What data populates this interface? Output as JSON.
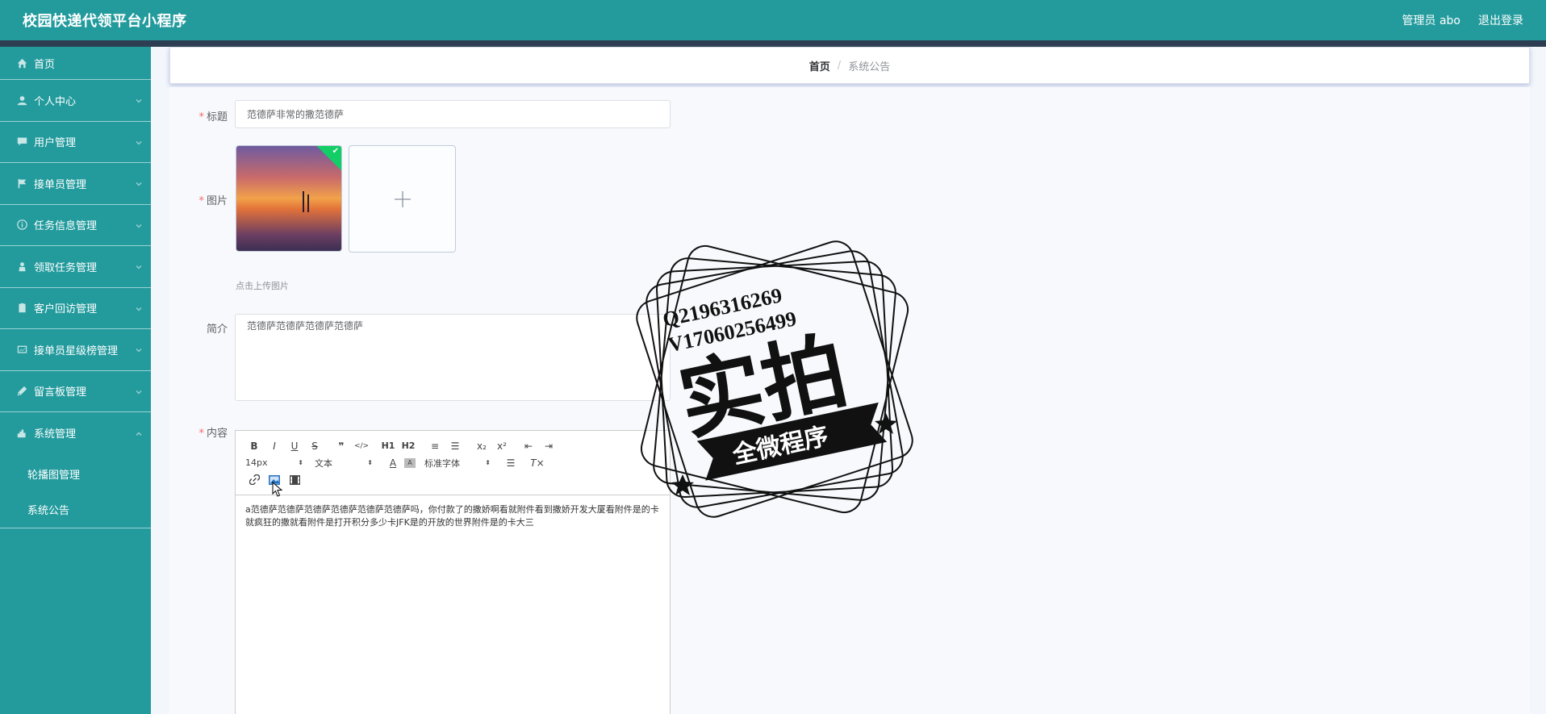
{
  "header": {
    "title": "校园快递代领平台小程序",
    "user_label": "管理员 abo",
    "logout_label": "退出登录"
  },
  "sidebar": {
    "items": [
      {
        "label": "首页",
        "icon": "home-icon"
      },
      {
        "label": "个人中心",
        "icon": "user-icon"
      },
      {
        "label": "用户管理",
        "icon": "chat-icon"
      },
      {
        "label": "接单员管理",
        "icon": "flag-icon"
      },
      {
        "label": "任务信息管理",
        "icon": "info-icon"
      },
      {
        "label": "领取任务管理",
        "icon": "person-icon"
      },
      {
        "label": "客户回访管理",
        "icon": "clipboard-icon"
      },
      {
        "label": "接单员星级榜管理",
        "icon": "chart-icon"
      },
      {
        "label": "留言板管理",
        "icon": "pen-icon"
      },
      {
        "label": "系统管理",
        "icon": "cog-icon"
      }
    ],
    "sub_items": [
      {
        "label": "轮播图管理"
      },
      {
        "label": "系统公告"
      }
    ]
  },
  "breadcrumb": {
    "home": "首页",
    "separator": "/",
    "current": "系统公告"
  },
  "form": {
    "title_label": "标题",
    "title_value": "范德萨非常的撒范德萨",
    "image_label": "图片",
    "upload_tip": "点击上传图片",
    "summary_label": "简介",
    "summary_value": "范德萨范德萨范德萨范德萨",
    "content_label": "内容",
    "content_value": "a范德萨范德萨范德萨范德萨范德萨范德萨吗，你付款了的撒娇啊看就附件看到撒娇开发大厦看附件是的卡就疯狂的撒就看附件是打开积分多少卡JFK是的开放的世界附件是的卡大三"
  },
  "editor": {
    "toolbar_row1": [
      "B",
      "I",
      "U",
      "S",
      "❞",
      "</>",
      "H1",
      "H2",
      "≡",
      "☰",
      "x₂",
      "x²",
      "⇤",
      "⇥"
    ],
    "font_size": "14px",
    "text_type": "文本",
    "font_family": "标准字体"
  },
  "watermark": {
    "contact_q": "Q2196316269",
    "contact_v": "V17060256499",
    "main_text": "实拍",
    "banner_text": "全微程序"
  },
  "colors": {
    "primary": "#239b9d",
    "dark_strip": "#2e3e52",
    "required": "#f56c6c"
  }
}
